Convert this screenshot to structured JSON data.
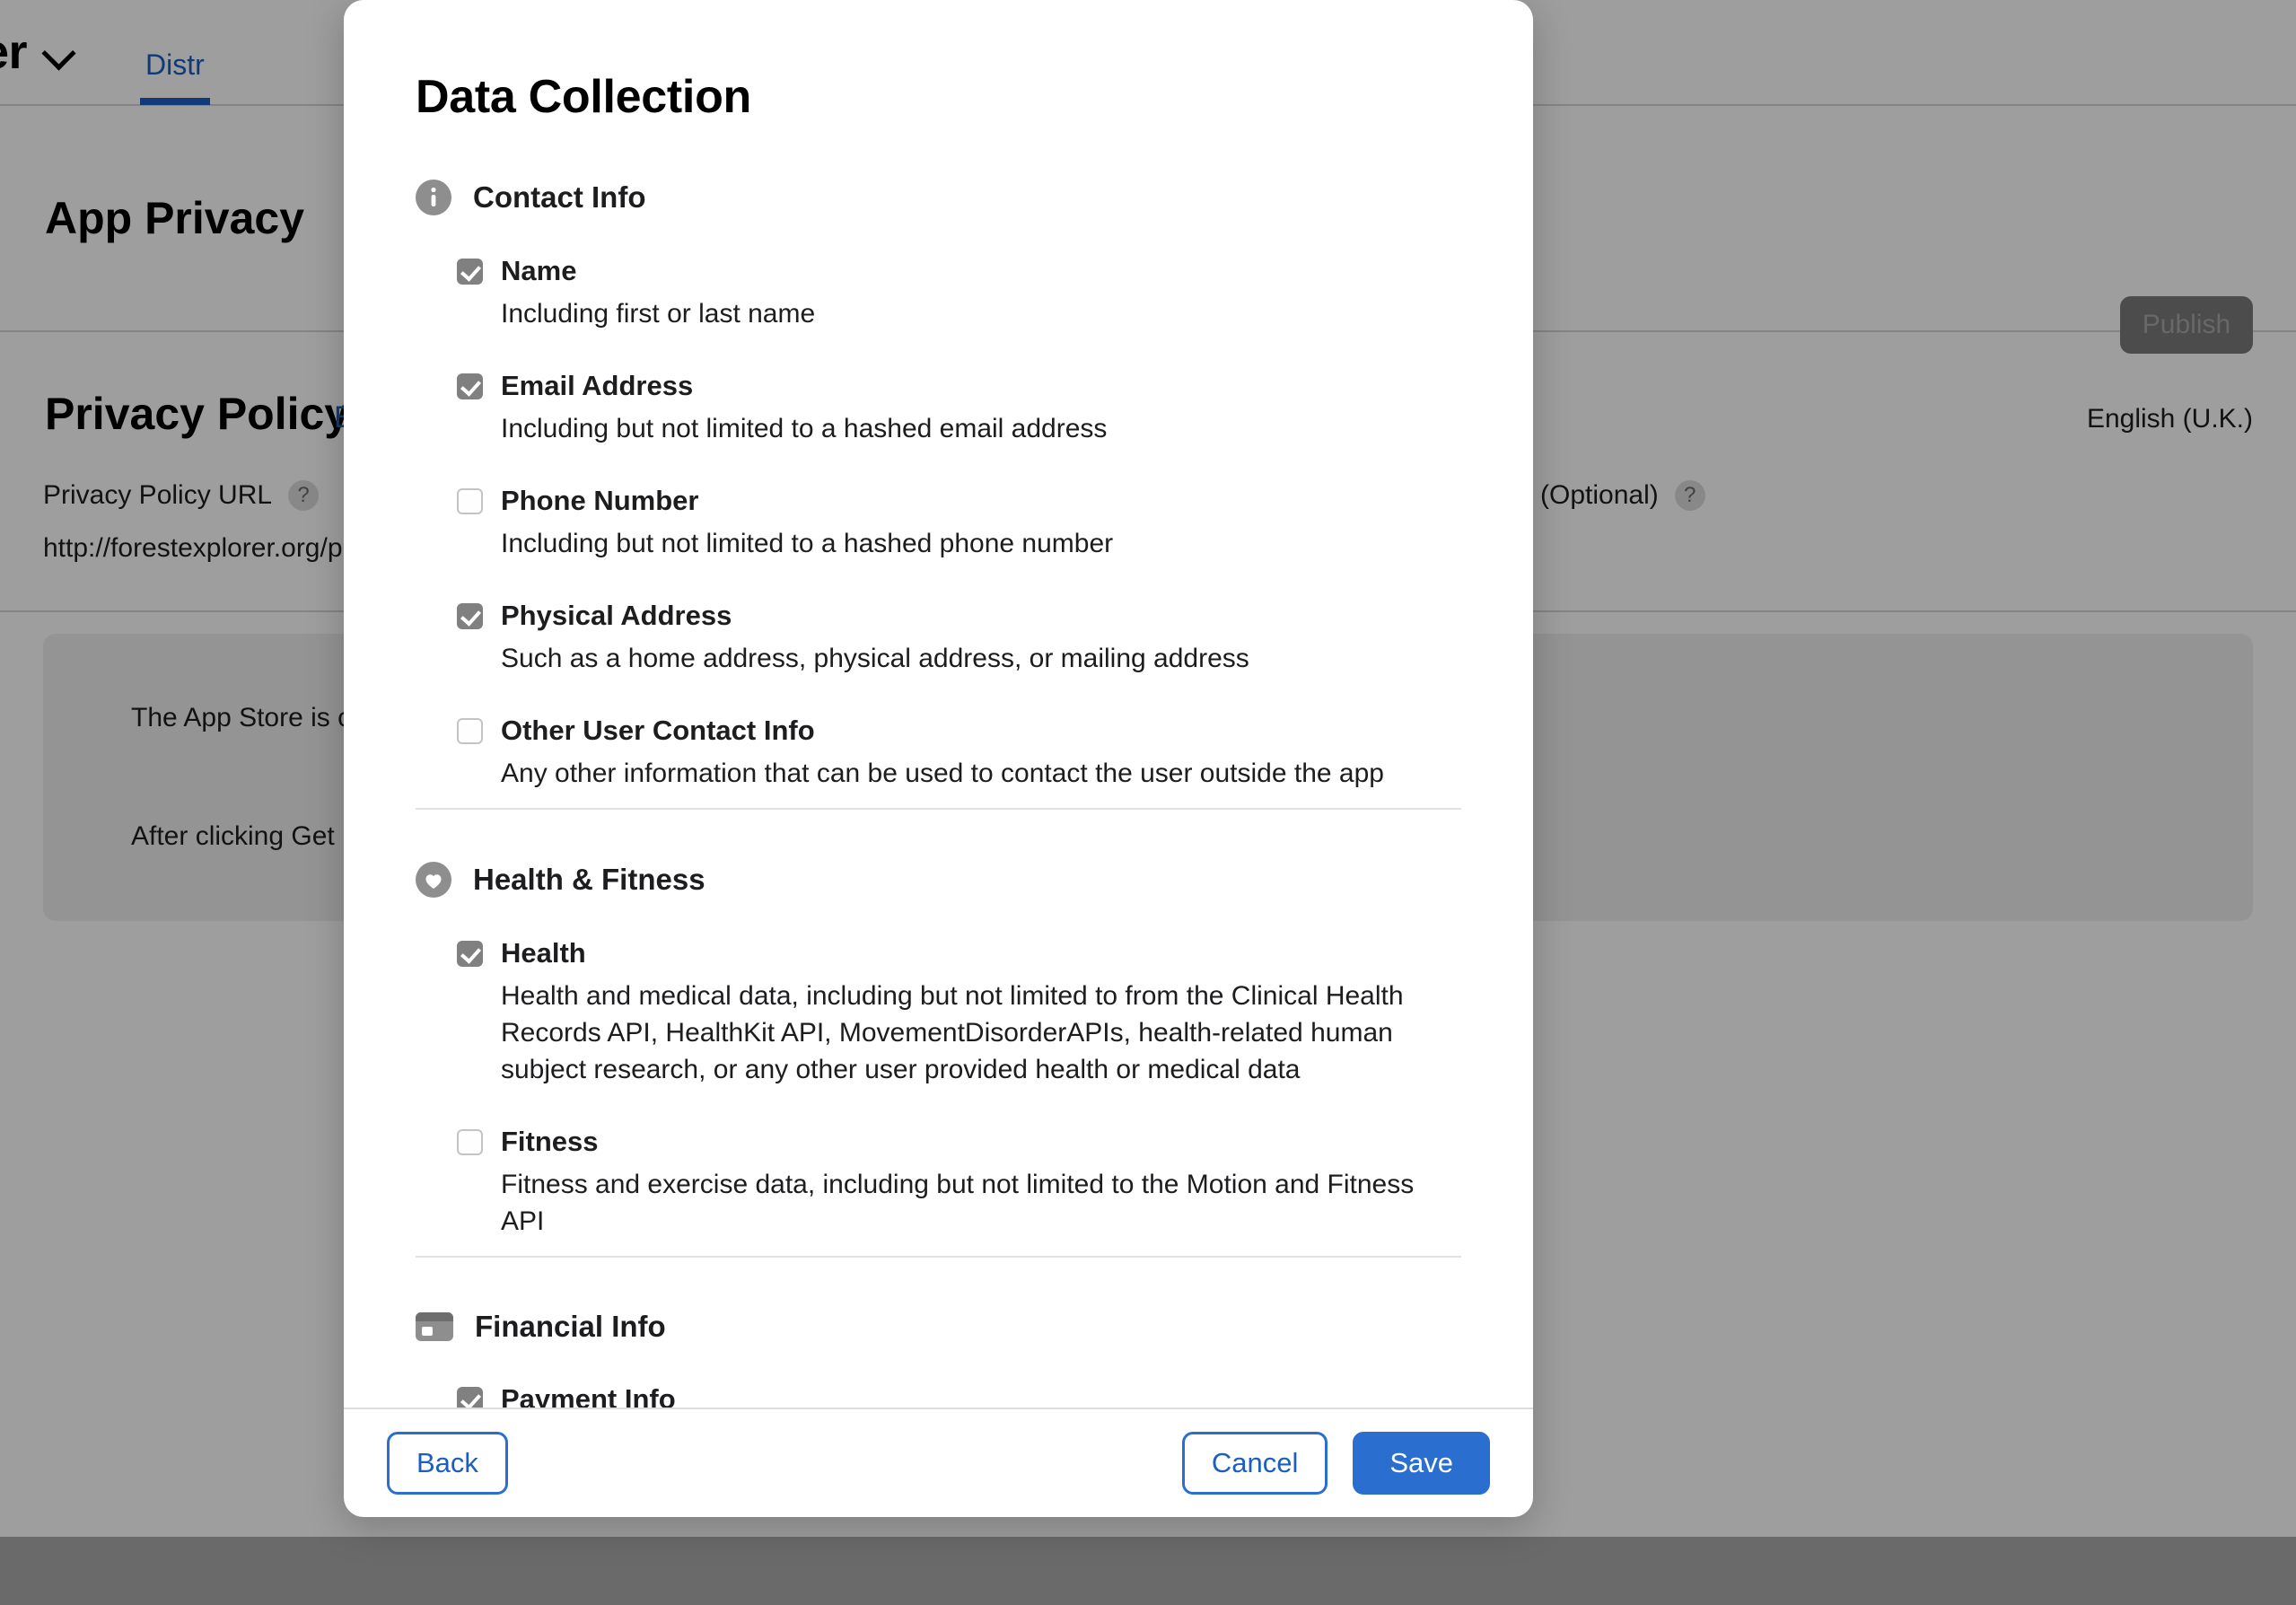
{
  "background": {
    "app_name": "plorer",
    "tabs": [
      {
        "label": "Distr",
        "active": true
      }
    ],
    "page_title": "App Privacy",
    "publish_label": "Publish",
    "section_title": "Privacy Policy",
    "section_edit_label": "E",
    "language": "English (U.K.)",
    "field_label": "Privacy Policy URL",
    "optional_label": "(Optional)",
    "help_glyph": "?",
    "field_value": "http://forestexplorer.org/p",
    "info_paragraph_1": "The App Store is c                                                                                                  e you. Your app can influence culture and change lives, so that's why we'r",
    "info_paragraph_2": "After clicking Get                                                                                                  information will appear on your app's product page, where users can s"
  },
  "modal": {
    "title": "Data Collection",
    "groups": [
      {
        "name": "Contact Info",
        "icon": "info-circle-icon",
        "options": [
          {
            "label": "Name",
            "description": "Including first or last name",
            "checked": true
          },
          {
            "label": "Email Address",
            "description": "Including but not limited to a hashed email address",
            "checked": true
          },
          {
            "label": "Phone Number",
            "description": "Including but not limited to a hashed phone number",
            "checked": false
          },
          {
            "label": "Physical Address",
            "description": "Such as a home address, physical address, or mailing address",
            "checked": true
          },
          {
            "label": "Other User Contact Info",
            "description": "Any other information that can be used to contact the user outside the app",
            "checked": false
          }
        ]
      },
      {
        "name": "Health & Fitness",
        "icon": "heart-circle-icon",
        "options": [
          {
            "label": "Health",
            "description": "Health and medical data, including but not limited to from the Clinical Health Records API, HealthKit API, MovementDisorderAPIs, health-related human subject research, or any other user provided health or medical data",
            "checked": true
          },
          {
            "label": "Fitness",
            "description": "Fitness and exercise data, including but not limited to the Motion and Fitness API",
            "checked": false
          }
        ]
      },
      {
        "name": "Financial Info",
        "icon": "credit-card-icon",
        "options": [
          {
            "label": "Payment Info",
            "description": "",
            "checked": true
          }
        ]
      }
    ],
    "footer": {
      "back_label": "Back",
      "cancel_label": "Cancel",
      "save_label": "Save"
    }
  },
  "colors": {
    "accent_blue": "#2a6fd0",
    "link_blue": "#1b5ec2",
    "checkbox_on": "#808080",
    "icon_gray": "#8e8e8e"
  }
}
